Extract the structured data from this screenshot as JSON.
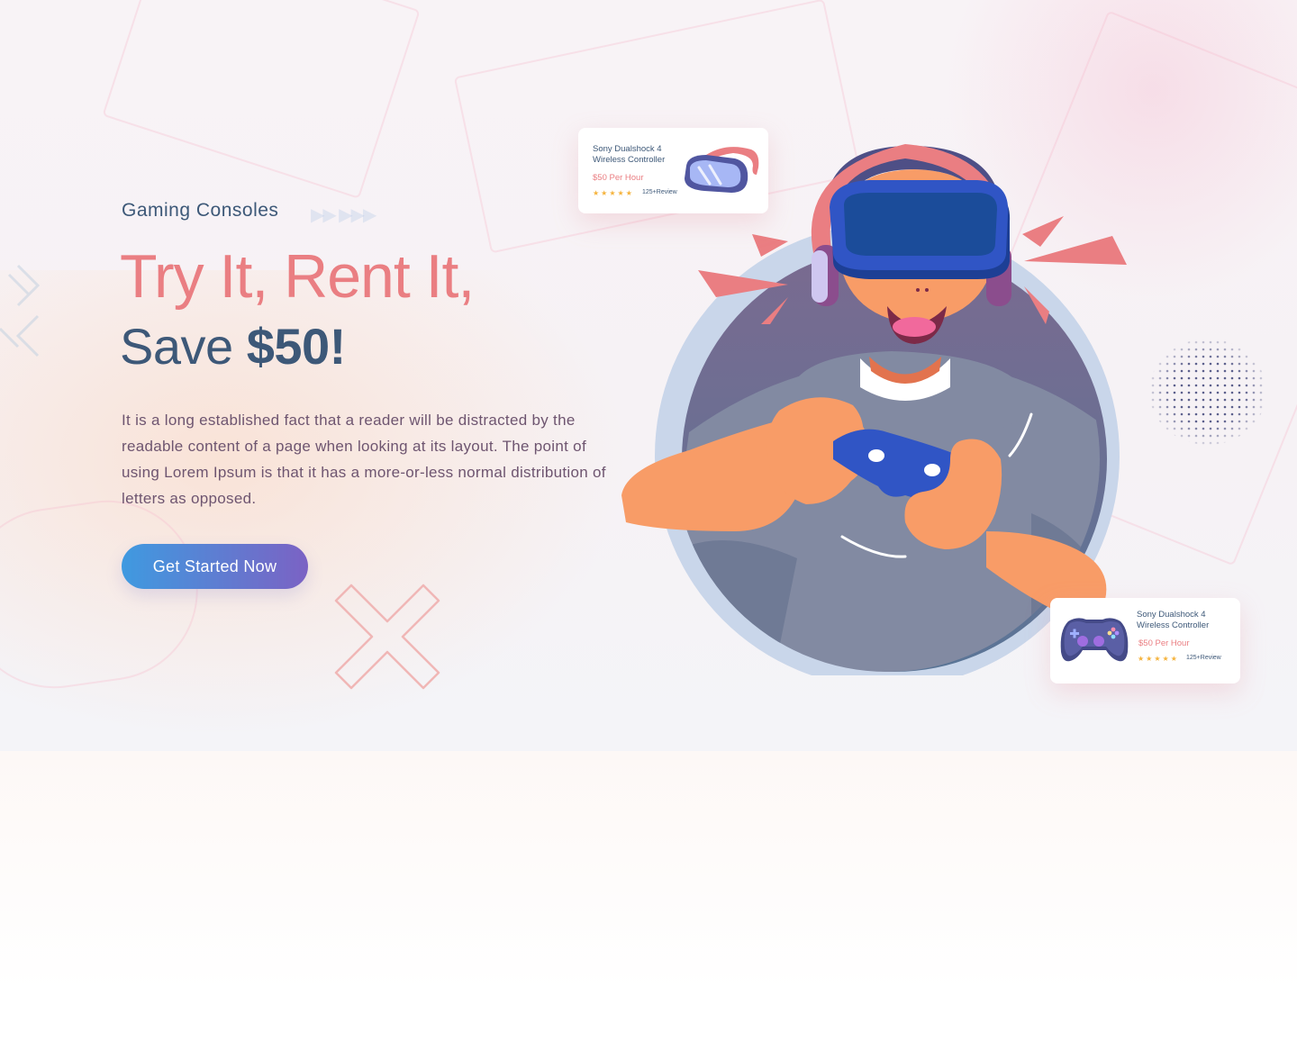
{
  "hero": {
    "subtitle": "Gaming Consoles",
    "title_line1": "Try It, Rent It,",
    "title_line2_prefix": "Save ",
    "title_line2_bold": "$50!",
    "description": "It is a long established fact that a reader will be distracted by the readable content of a page when looking at its layout. The point of using Lorem Ipsum is that it has a more-or-less normal distribution of letters as opposed.",
    "cta_label": "Get Started Now",
    "arrows": "▶▶ ▶▶▶"
  },
  "cards": [
    {
      "title": "Sony Dualshock 4 Wireless Controller",
      "price": "$50 Per Hour",
      "stars": "★★★★★",
      "rating": 5,
      "review": "125+Review",
      "image_icon": "vr-headset-icon"
    },
    {
      "title": "Sony Dualshock 4 Wireless Controller",
      "price": "$50 Per Hour",
      "stars": "★★★★★",
      "rating": 5,
      "review": "125+Review",
      "image_icon": "gamepad-icon"
    }
  ],
  "colors": {
    "accent_pink": "#ea7e82",
    "navy_text": "#3d5878",
    "body_text": "#6e5570",
    "cta_gradient_start": "#3f9ae0",
    "cta_gradient_end": "#7b62c4",
    "star": "#f5b33c"
  }
}
